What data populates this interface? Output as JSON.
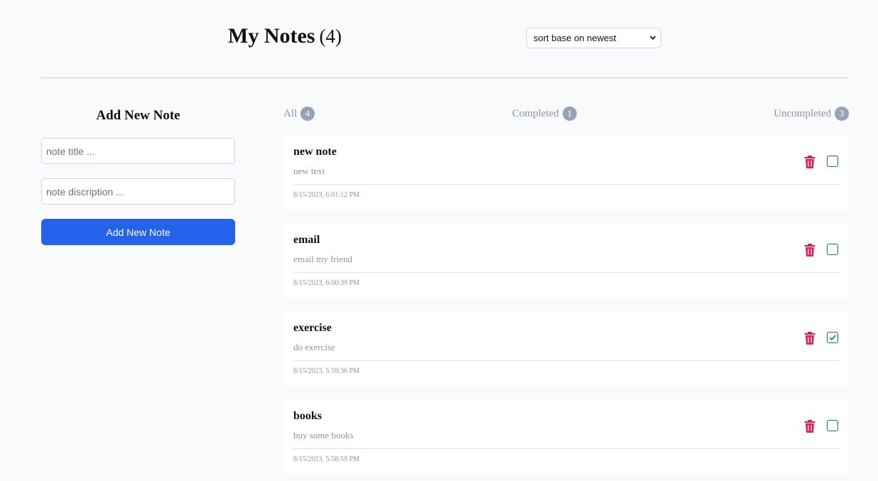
{
  "header": {
    "title": "My Notes",
    "count": "(4)",
    "sort": {
      "selected": "sort base on newest"
    }
  },
  "add_note": {
    "heading": "Add New Note",
    "title_placeholder": "note title ...",
    "description_placeholder": "note discription ...",
    "button_label": "Add New Note"
  },
  "tabs": [
    {
      "label": "All",
      "count": "4"
    },
    {
      "label": "Completed",
      "count": "1"
    },
    {
      "label": "Uncompleted",
      "count": "3"
    }
  ],
  "notes": [
    {
      "title": "new note",
      "description": "new text",
      "date": "8/15/2023, 6:01:12 PM",
      "completed": false
    },
    {
      "title": "email",
      "description": "email my friend",
      "date": "8/15/2023, 6:00:39 PM",
      "completed": false
    },
    {
      "title": "exercise",
      "description": "do exercise",
      "date": "8/15/2023, 5:59:36 PM",
      "completed": true
    },
    {
      "title": "books",
      "description": "buy some books",
      "date": "8/15/2023, 5:58:59 PM",
      "completed": false
    }
  ],
  "colors": {
    "accent": "#2563eb",
    "danger": "#e11d48",
    "check": "#0f766e",
    "badge": "#94a3b8",
    "muted_text": "#8a93ab",
    "background": "#f8fafc"
  }
}
